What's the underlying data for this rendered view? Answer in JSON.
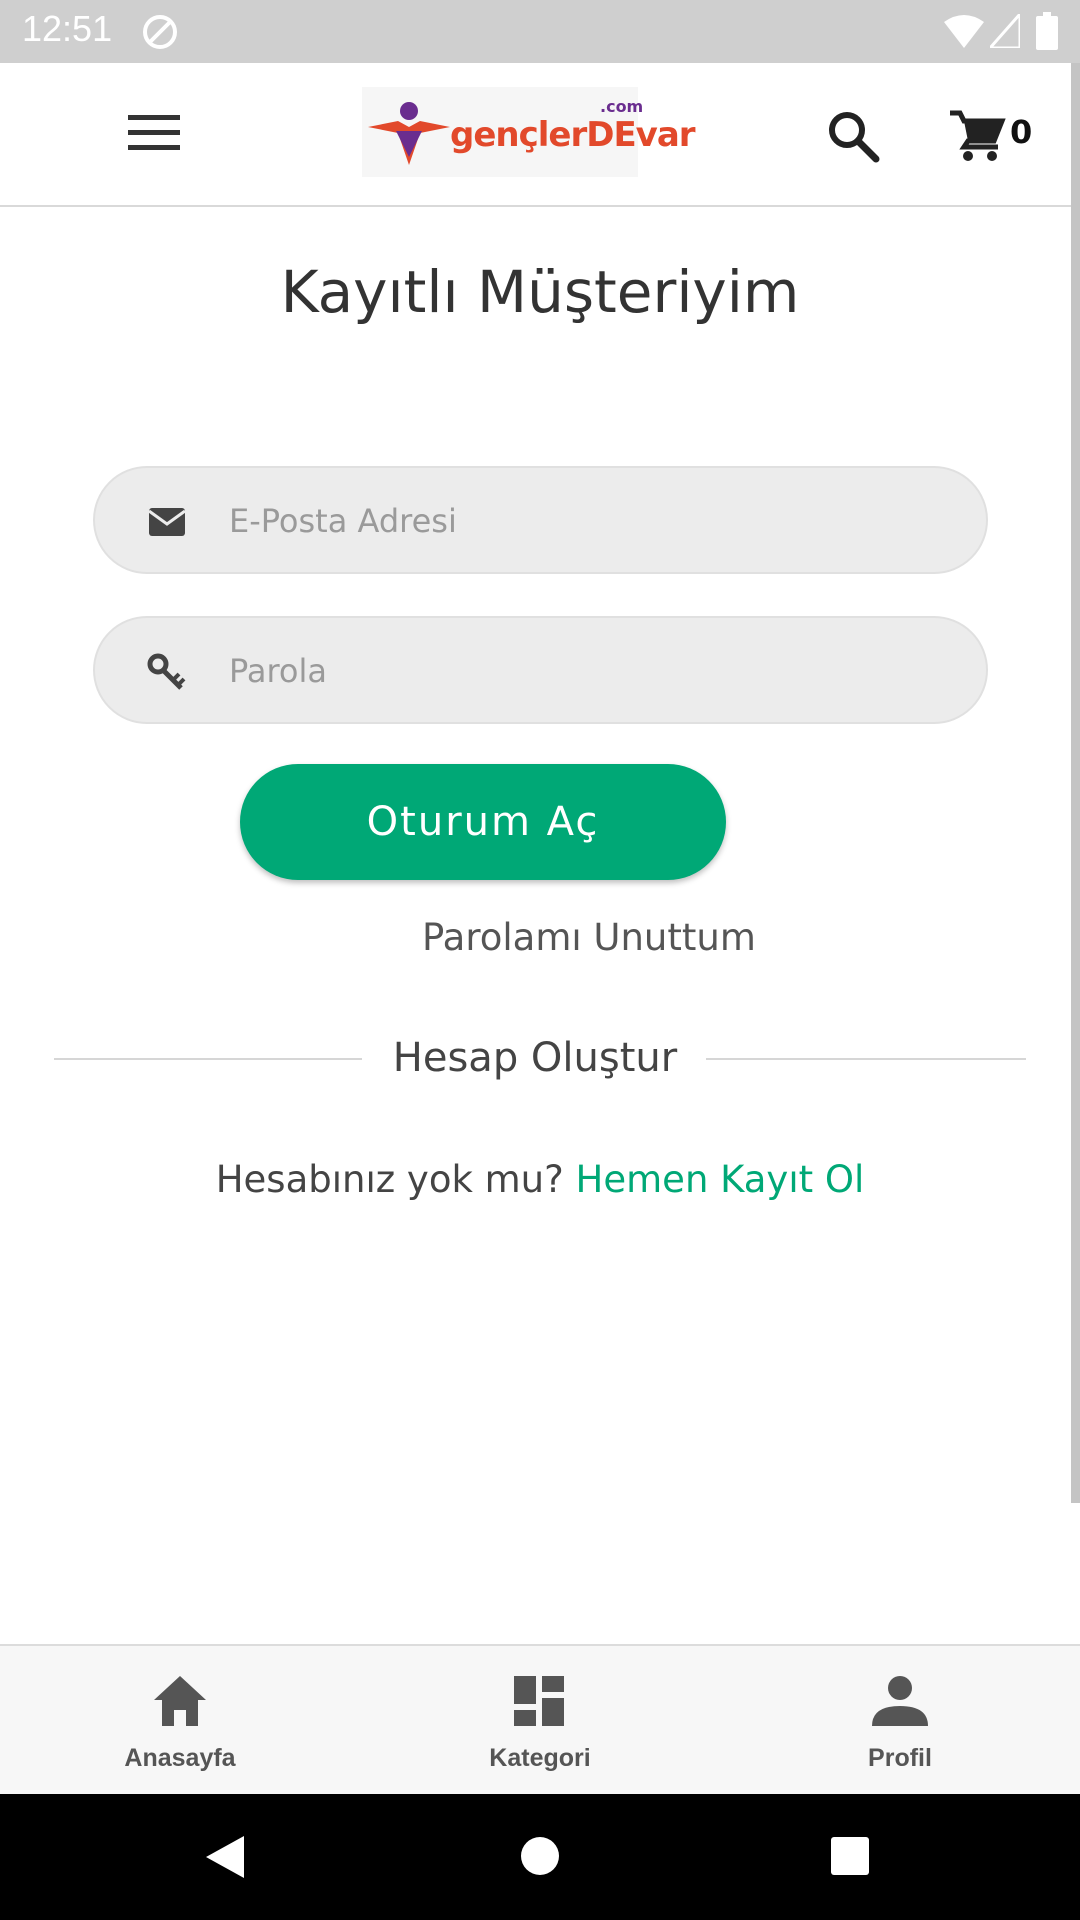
{
  "status_bar": {
    "time": "12:51"
  },
  "header": {
    "logo_text": "gençlerDEvar",
    "logo_domain": ".com",
    "cart_count": "0"
  },
  "main": {
    "title": "Kayıtlı Müşteriyim",
    "email_placeholder": "E-Posta Adresi",
    "password_placeholder": "Parola",
    "login_button": "Oturum Aç",
    "forgot_password": "Parolamı Unuttum",
    "create_account_heading": "Hesap Oluştur",
    "no_account_text": "Hesabınız yok mu?",
    "register_link": "Hemen Kayıt Ol"
  },
  "bottom_nav": {
    "items": [
      {
        "label": "Anasayfa",
        "icon": "home-icon"
      },
      {
        "label": "Kategori",
        "icon": "category-icon"
      },
      {
        "label": "Profil",
        "icon": "profile-icon"
      }
    ]
  },
  "colors": {
    "accent": "#00a876",
    "status_bar": "#cfcfcf"
  }
}
